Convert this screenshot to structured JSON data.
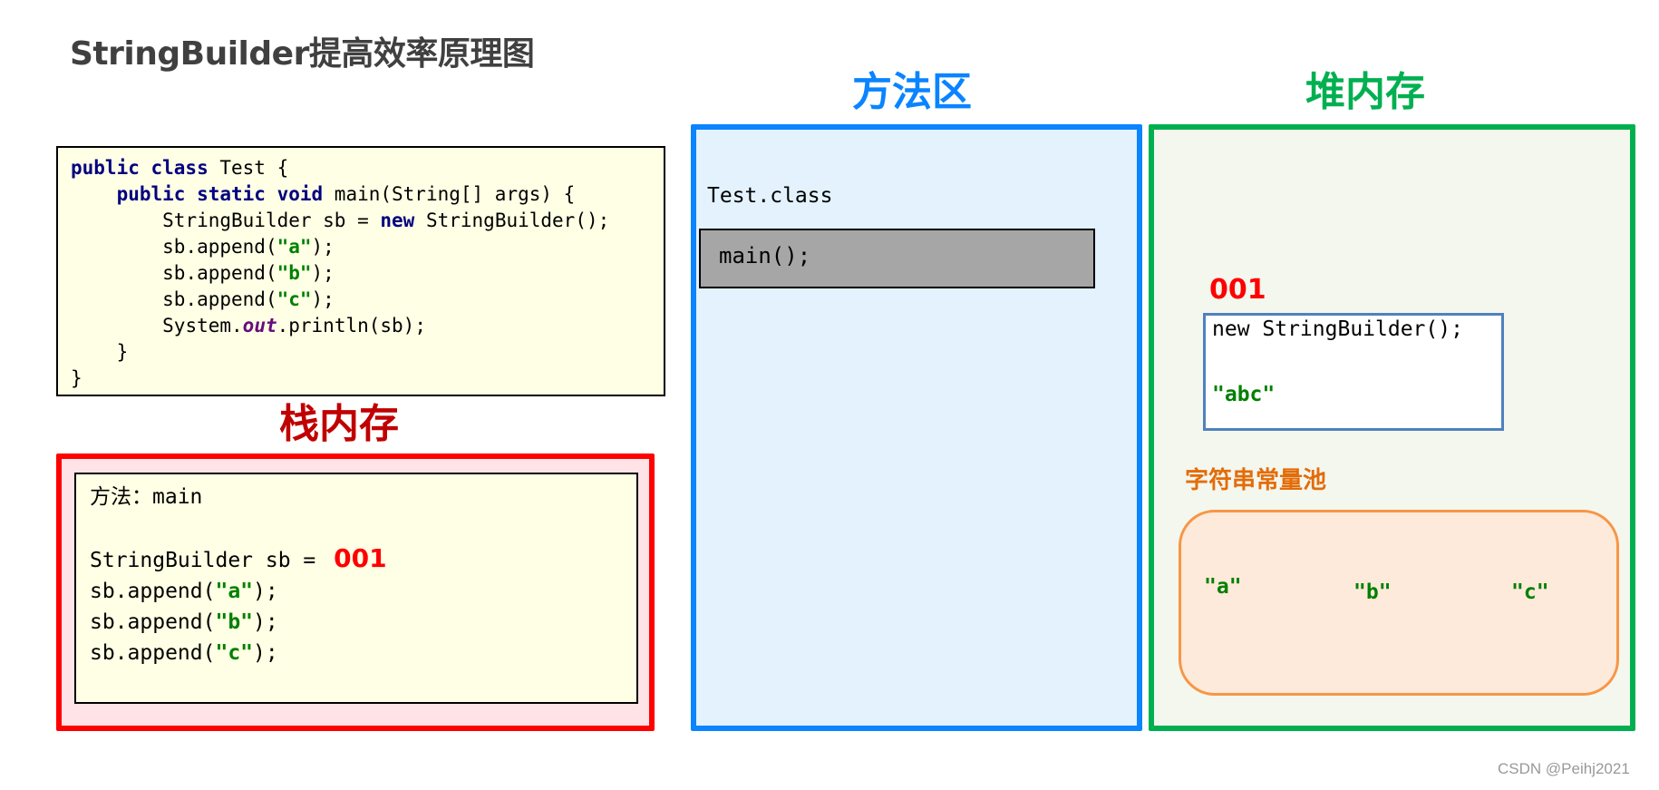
{
  "title": "StringBuilder提高效率原理图",
  "code": {
    "lines": [
      {
        "indent": "",
        "parts": [
          {
            "t": "public class",
            "c": "kw"
          },
          {
            "t": " Test {",
            "c": ""
          }
        ]
      },
      {
        "indent": "    ",
        "parts": [
          {
            "t": "public static void",
            "c": "kw"
          },
          {
            "t": " main(String[] args) {",
            "c": ""
          }
        ]
      },
      {
        "indent": "        ",
        "parts": [
          {
            "t": "StringBuilder sb = ",
            "c": ""
          },
          {
            "t": "new",
            "c": "kw"
          },
          {
            "t": " StringBuilder();",
            "c": ""
          }
        ]
      },
      {
        "indent": "        ",
        "parts": [
          {
            "t": "sb.append(",
            "c": ""
          },
          {
            "t": "\"a\"",
            "c": "str"
          },
          {
            "t": ");",
            "c": ""
          }
        ]
      },
      {
        "indent": "        ",
        "parts": [
          {
            "t": "sb.append(",
            "c": ""
          },
          {
            "t": "\"b\"",
            "c": "str"
          },
          {
            "t": ");",
            "c": ""
          }
        ]
      },
      {
        "indent": "        ",
        "parts": [
          {
            "t": "sb.append(",
            "c": ""
          },
          {
            "t": "\"c\"",
            "c": "str"
          },
          {
            "t": ");",
            "c": ""
          }
        ]
      },
      {
        "indent": "        ",
        "parts": [
          {
            "t": "System.",
            "c": ""
          },
          {
            "t": "out",
            "c": "fld"
          },
          {
            "t": ".println(sb);",
            "c": ""
          }
        ]
      },
      {
        "indent": "    ",
        "parts": [
          {
            "t": "}",
            "c": ""
          }
        ]
      },
      {
        "indent": "",
        "parts": [
          {
            "t": "}",
            "c": ""
          }
        ]
      }
    ]
  },
  "stack": {
    "title": "栈内存",
    "method_label": "方法：main",
    "declaration": "StringBuilder sb = ",
    "reference": "001",
    "calls": [
      {
        "prefix": "sb.append(",
        "arg": "\"a\"",
        "suffix": ");"
      },
      {
        "prefix": "sb.append(",
        "arg": "\"b\"",
        "suffix": ");"
      },
      {
        "prefix": "sb.append(",
        "arg": "\"c\"",
        "suffix": ");"
      }
    ]
  },
  "method_area": {
    "title": "方法区",
    "class_name": "Test.class",
    "method": "main();"
  },
  "heap": {
    "title": "堆内存",
    "object_address": "001",
    "object_code": "new StringBuilder();",
    "object_value": "\"abc\"",
    "pool_label": "字符串常量池",
    "pool_strings": [
      "\"a\"",
      "\"b\"",
      "\"c\""
    ]
  },
  "colors": {
    "stack": "#ff0000",
    "method_area": "#0a84ff",
    "heap": "#00b050",
    "pool": "#f79646",
    "reference": "#ff0000",
    "string_literal": "#008000"
  },
  "watermark": "CSDN @Peihj2021"
}
